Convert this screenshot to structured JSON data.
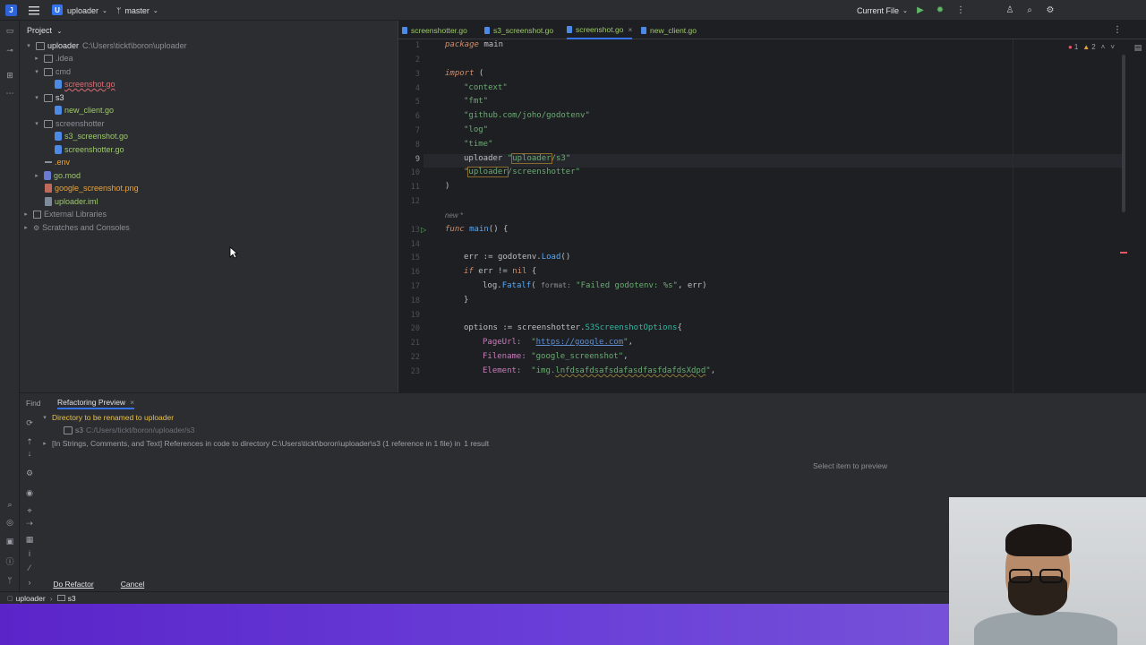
{
  "topbar": {
    "app_icon": "J",
    "project_badge": "U",
    "project_name": "uploader",
    "branch": "master",
    "run_config": "Current File",
    "icons": [
      "hamburger-icon",
      "chevron-down-icon",
      "branch-icon",
      "run-icon",
      "debug-icon",
      "more-icon",
      "account-icon",
      "search-icon",
      "settings-icon"
    ]
  },
  "project_panel": {
    "title": "Project",
    "root_label": "uploader",
    "root_path": "C:\\Users\\tickt\\boron\\uploader",
    "items": [
      {
        "label": ".idea",
        "kind": "folder"
      },
      {
        "label": "cmd",
        "kind": "folder"
      },
      {
        "label": "screenshot.go",
        "kind": "go"
      },
      {
        "label": "s3",
        "kind": "folder"
      },
      {
        "label": "new_client.go",
        "kind": "go"
      },
      {
        "label": "screenshotter",
        "kind": "folder"
      },
      {
        "label": "s3_screenshot.go",
        "kind": "go"
      },
      {
        "label": "screenshotter.go",
        "kind": "go"
      },
      {
        "label": ".env",
        "kind": "env"
      },
      {
        "label": "go.mod",
        "kind": "mod"
      },
      {
        "label": "google_screenshot.png",
        "kind": "png"
      },
      {
        "label": "uploader.iml",
        "kind": "iml"
      },
      {
        "label": "External Libraries",
        "kind": "lib"
      },
      {
        "label": "Scratches and Consoles",
        "kind": "scratch"
      }
    ]
  },
  "editor": {
    "tabs": [
      {
        "label": "screenshotter.go"
      },
      {
        "label": "s3_screenshot.go"
      },
      {
        "label": "screenshot.go",
        "active": true
      },
      {
        "label": "new_client.go"
      }
    ],
    "inspections": {
      "errors": "1",
      "warnings": "2"
    },
    "line_numbers": [
      "1",
      "2",
      "3",
      "4",
      "5",
      "6",
      "7",
      "8",
      "9",
      "10",
      "11",
      "12",
      "13",
      "14",
      "15",
      "16",
      "17",
      "18",
      "19",
      "20",
      "21",
      "22",
      "23"
    ],
    "usage_hint": "new *",
    "code": {
      "l1_kw": "package",
      "l1_name": " main",
      "l3_kw": "import",
      "l3_rest": " (",
      "l4": "\"context\"",
      "l5": "\"fmt\"",
      "l6": "\"github.com/joho/godotenv\"",
      "l7": "\"log\"",
      "l8": "\"time\"",
      "l9_alias": "uploader ",
      "l9_q": "\"",
      "l9_boxed": "uploader",
      "l9_rest": "/s3\"",
      "l10_q": "\"",
      "l10_boxed": "uploader",
      "l10_rest": "/screenshotter\"",
      "l11": ")",
      "l13_kw": "func",
      "l13_fn": " main",
      "l13_rest": "() {",
      "l15_a": "err := ",
      "l15_pkg": "godotenv",
      "l15_b": ".",
      "l15_fn": "Load",
      "l15_c": "()",
      "l16_kw": "if",
      "l16_a": " err ",
      "l16_op": "!=",
      "l16_nil": " nil",
      "l16_b": " {",
      "l17_pkg": "log",
      "l17_b": ".",
      "l17_fn": "Fatalf",
      "l17_c": "( ",
      "l17_hint": "format:",
      "l17_str": " \"Failed godotenv: %s\"",
      "l17_d": ", err)",
      "l18": "}",
      "l20_a": "options := ",
      "l20_pkg": "screenshotter",
      "l20_b": ".",
      "l20_type": "S3ScreenshotOptions",
      "l20_c": "{",
      "l21_key": "PageUrl:  ",
      "l21_str_a": "\"",
      "l21_url": "https://google.com",
      "l21_str_b": "\"",
      "l21_c": ",",
      "l22_key": "Filename: ",
      "l22_str": "\"google_screenshot\"",
      "l22_c": ",",
      "l23_key": "Element:  ",
      "l23_str_a": "\"img.",
      "l23_warn": "lnfdsafdsafsdafasdfasfdafdsXdpd",
      "l23_str_b": "\"",
      "l23_c": ","
    }
  },
  "bottom_panel": {
    "tabs": [
      {
        "label": "Find"
      },
      {
        "label": "Refactoring Preview",
        "active": true
      }
    ],
    "rows": {
      "rename_title": "Directory to be renamed to uploader",
      "dir_name": "s3",
      "dir_path": "C:/Users/tickt/boron/uploader/s3",
      "references": "[In Strings, Comments, and Text] References in code to directory C:\\Users\\tickt\\boron\\uploader\\s3 (1 reference in 1 file) in",
      "result_count": "1 result"
    },
    "preview_placeholder": "Select item to preview",
    "do_refactor": "Do Refactor",
    "cancel": "Cancel"
  },
  "statusbar": {
    "crumb1": "uploader",
    "crumb2": "s3"
  },
  "colors": {
    "accent": "#3574f0",
    "bg_editor": "#1e1f22",
    "bg_panel": "#2b2d30",
    "purple_banner": "#6a3fd8"
  }
}
